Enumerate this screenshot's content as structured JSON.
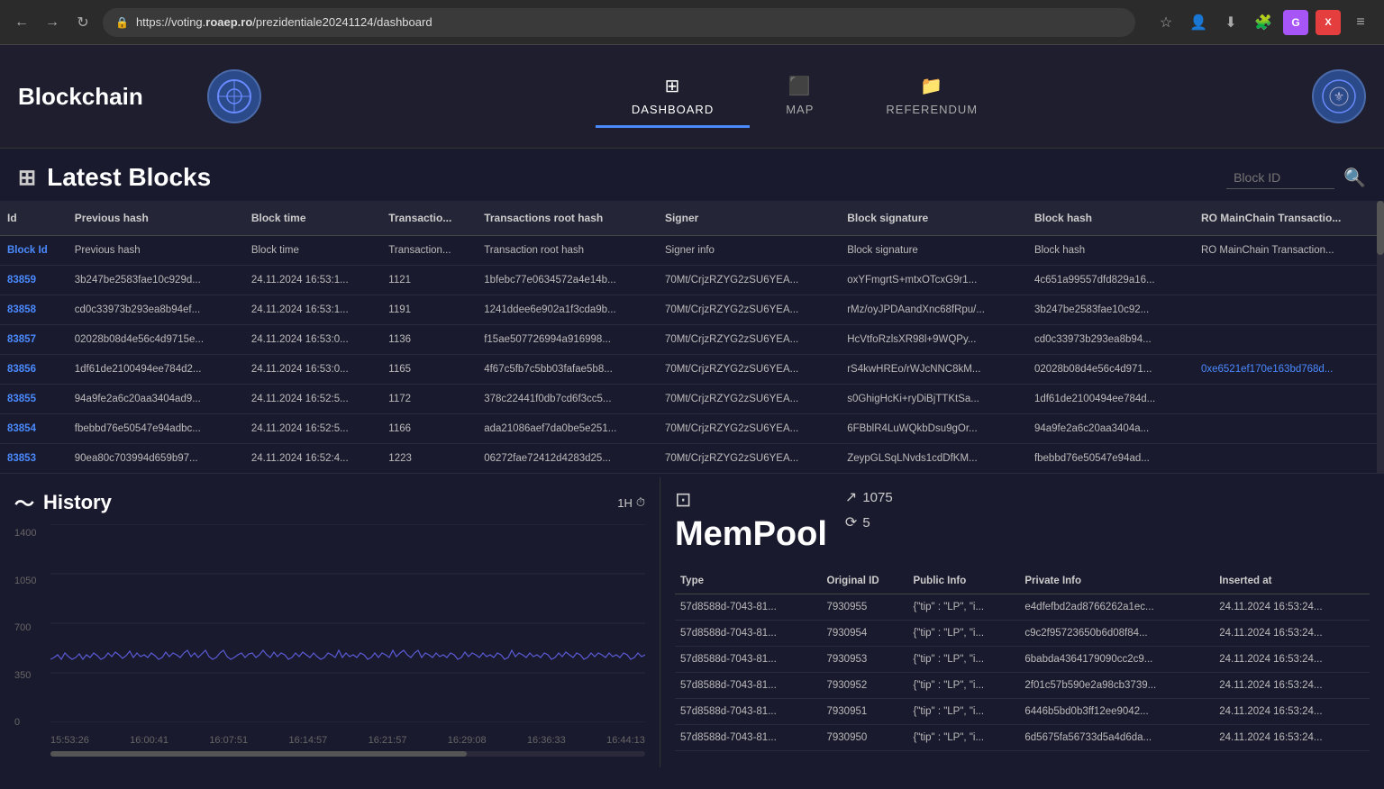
{
  "browser": {
    "back_icon": "←",
    "forward_icon": "→",
    "reload_icon": "↻",
    "url": "https://voting.",
    "url_bold": "roaep.ro",
    "url_rest": "/prezidentiale20241124/dashboard",
    "bookmark_icon": "☆",
    "favorite_icon": "♡",
    "profile_icon": "👤",
    "extensions_icon": "🧩",
    "grammarly_label": "G",
    "ext_red_label": "X",
    "menu_icon": "≡"
  },
  "header": {
    "app_title": "Blockchain",
    "logo_left": "⊕",
    "nav_tabs": [
      {
        "id": "dashboard",
        "icon": "⊞",
        "label": "DASHBOARD",
        "active": true
      },
      {
        "id": "map",
        "icon": "⬛",
        "label": "MAP",
        "active": false
      },
      {
        "id": "referendum",
        "icon": "📁",
        "label": "REFERENDUM",
        "active": false
      }
    ],
    "logo_right": "⊕"
  },
  "latest_blocks": {
    "title": "Latest Blocks",
    "grid_icon": "⊞",
    "search_placeholder": "Block ID",
    "search_icon": "🔍",
    "columns": [
      "Id",
      "Previous hash",
      "Block time",
      "Transactio...",
      "Transactions root hash",
      "Signer",
      "Block signature",
      "Block hash",
      "RO MainChain Transactio..."
    ],
    "dim_row": [
      "Block Id",
      "Previous hash",
      "Block time",
      "Transaction...",
      "Transaction root hash",
      "Signer info",
      "Block signature",
      "Block hash",
      "RO MainChain Transaction..."
    ],
    "rows": [
      {
        "id": "83859",
        "prev_hash": "3b247be2583fae10c929d...",
        "block_time": "24.11.2024 16:53:1...",
        "transactions": "1121",
        "tx_root_hash": "1bfebc77e0634572a4e14b...",
        "signer": "70Mt/CrjzRZYG2zSU6YEA...",
        "block_sig": "oxYFmgrtS+mtxOTcxG9r1...",
        "block_hash": "4c651a99557dfd829a16...",
        "mainchain": ""
      },
      {
        "id": "83858",
        "prev_hash": "cd0c33973b293ea8b94ef...",
        "block_time": "24.11.2024 16:53:1...",
        "transactions": "1191",
        "tx_root_hash": "1241ddee6e902a1f3cda9b...",
        "signer": "70Mt/CrjzRZYG2zSU6YEA...",
        "block_sig": "rMz/oyJPDAandXnc68fRpu/...",
        "block_hash": "3b247be2583fae10c92...",
        "mainchain": ""
      },
      {
        "id": "83857",
        "prev_hash": "02028b08d4e56c4d9715e...",
        "block_time": "24.11.2024 16:53:0...",
        "transactions": "1136",
        "tx_root_hash": "f15ae507726994a916998...",
        "signer": "70Mt/CrjzRZYG2zSU6YEA...",
        "block_sig": "HcVtfoRzlsXR98l+9WQPy...",
        "block_hash": "cd0c33973b293ea8b94...",
        "mainchain": ""
      },
      {
        "id": "83856",
        "prev_hash": "1df61de2100494ee784d2...",
        "block_time": "24.11.2024 16:53:0...",
        "transactions": "1165",
        "tx_root_hash": "4f67c5fb7c5bb03fafae5b8...",
        "signer": "70Mt/CrjzRZYG2zSU6YEA...",
        "block_sig": "rS4kwHREo/rWJcNNC8kM...",
        "block_hash": "02028b08d4e56c4d971...",
        "mainchain": "0xe6521ef170e163bd768d..."
      },
      {
        "id": "83855",
        "prev_hash": "94a9fe2a6c20aa3404ad9...",
        "block_time": "24.11.2024 16:52:5...",
        "transactions": "1172",
        "tx_root_hash": "378c22441f0db7cd6f3cc5...",
        "signer": "70Mt/CrjzRZYG2zSU6YEA...",
        "block_sig": "s0GhigHcKi+ryDiBjTTKtSa...",
        "block_hash": "1df61de2100494ee784d...",
        "mainchain": ""
      },
      {
        "id": "83854",
        "prev_hash": "fbebbd76e50547e94adbc...",
        "block_time": "24.11.2024 16:52:5...",
        "transactions": "1166",
        "tx_root_hash": "ada21086aef7da0be5e251...",
        "signer": "70Mt/CrjzRZYG2zSU6YEA...",
        "block_sig": "6FBblR4LuWQkbDsu9gOr...",
        "block_hash": "94a9fe2a6c20aa3404a...",
        "mainchain": ""
      },
      {
        "id": "83853",
        "prev_hash": "90ea80c703994d659b97...",
        "block_time": "24.11.2024 16:52:4...",
        "transactions": "1223",
        "tx_root_hash": "06272fae72412d4283d25...",
        "signer": "70Mt/CrjzRZYG2zSU6YEA...",
        "block_sig": "ZeypGLSqLNvds1cdDfKM...",
        "block_hash": "fbebbd76e50547e94ad...",
        "mainchain": ""
      }
    ]
  },
  "history": {
    "title": "History",
    "chart_icon": "〜",
    "timerange": "1H",
    "clock_icon": "⏱",
    "y_labels": [
      "1400",
      "1050",
      "700",
      "350",
      "0"
    ],
    "x_labels": [
      "15:53:26",
      "16:00:41",
      "16:07:51",
      "16:14:57",
      "16:21:57",
      "16:29:08",
      "16:36:33",
      "16:44:13"
    ]
  },
  "mempool": {
    "title": "MemPool",
    "crop_icon": "⊡",
    "stats": [
      {
        "icon": "↗",
        "value": "1075"
      },
      {
        "icon": "⟳",
        "value": "5"
      }
    ],
    "columns": [
      "Type",
      "Original ID",
      "Public Info",
      "Private Info",
      "Inserted at"
    ],
    "rows": [
      {
        "type": "57d8588d-7043-81...",
        "original_id": "7930955",
        "public_info": "{\"tip\" : \"LP\", \"i...",
        "private_info": "e4dfefbd2ad8766262a1ec...",
        "inserted_at": "24.11.2024 16:53:24..."
      },
      {
        "type": "57d8588d-7043-81...",
        "original_id": "7930954",
        "public_info": "{\"tip\" : \"LP\", \"i...",
        "private_info": "c9c2f95723650b6d08f84...",
        "inserted_at": "24.11.2024 16:53:24..."
      },
      {
        "type": "57d8588d-7043-81...",
        "original_id": "7930953",
        "public_info": "{\"tip\" : \"LP\", \"i...",
        "private_info": "6babda4364179090cc2c9...",
        "inserted_at": "24.11.2024 16:53:24..."
      },
      {
        "type": "57d8588d-7043-81...",
        "original_id": "7930952",
        "public_info": "{\"tip\" : \"LP\", \"i...",
        "private_info": "2f01c57b590e2a98cb3739...",
        "inserted_at": "24.11.2024 16:53:24..."
      },
      {
        "type": "57d8588d-7043-81...",
        "original_id": "7930951",
        "public_info": "{\"tip\" : \"LP\", \"i...",
        "private_info": "6446b5bd0b3ff12ee9042...",
        "inserted_at": "24.11.2024 16:53:24..."
      },
      {
        "type": "57d8588d-7043-81...",
        "original_id": "7930950",
        "public_info": "{\"tip\" : \"LP\", \"i...",
        "private_info": "6d5675fa56733d5a4d6da...",
        "inserted_at": "24.11.2024 16:53:24..."
      }
    ]
  }
}
